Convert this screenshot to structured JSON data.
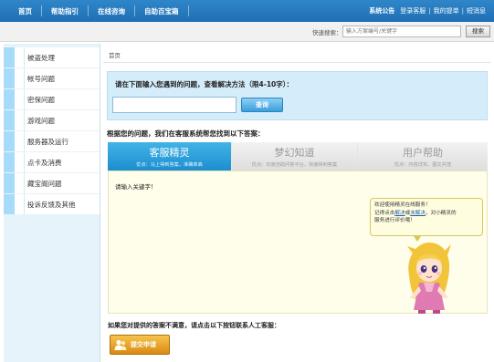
{
  "topnav": {
    "items": [
      "首页",
      "帮助指引",
      "在线咨询",
      "自助百宝箱"
    ]
  },
  "toplinks": {
    "announce": "系统公告",
    "login": "登录客服",
    "orders": "我的提单",
    "messages": "短消息"
  },
  "search": {
    "label": "快速搜索：",
    "placeholder": "输入方案编号/关键字",
    "button": "搜索"
  },
  "sidebar": {
    "items": [
      {
        "label": "被盗处理"
      },
      {
        "label": "帐号问题"
      },
      {
        "label": "密保问题"
      },
      {
        "label": "游戏问题"
      },
      {
        "label": "服务器及运行"
      },
      {
        "label": "点卡及消费"
      },
      {
        "label": "藏宝阁问题"
      },
      {
        "label": "投诉反馈及其他"
      }
    ]
  },
  "main": {
    "breadcrumb": "首页",
    "query": {
      "title": "请在下面输入您遇到的问题，查看解决方法（限4-10字）：",
      "input_value": "",
      "button": "查询"
    },
    "help_line": "根据您的问题，我们在客服系统帮您找到以下答案：",
    "tabs": [
      {
        "name": "客服精灵",
        "sub": "优点：马上得到答案，准确率高"
      },
      {
        "name": "梦幻知道",
        "sub": "优点：玩家自助问答平台，快速得到答案"
      },
      {
        "name": "用户帮助",
        "sub": "优点：内容详实，图文并茂"
      }
    ],
    "chat_prompt": "请输入关键字！",
    "bubble": {
      "line1": "欢迎使用精灵在线服务！",
      "line2_pre": "记得点击",
      "link1": "解决",
      "mid": "或",
      "link2": "未解决",
      "line2_post": "，对小精灵的",
      "line3": "服务进行评价哦！"
    },
    "complain_text": "如果您对提供的答案不满意，请点击以下按钮联系人工客服：",
    "submit_button": "提交申请"
  },
  "colors": {
    "top_bar": "#1f6fb3",
    "accent": "#1c8ed0",
    "sidebar_stripe": "#a7dcf8",
    "submit": "#d98a11"
  },
  "icons": {
    "submit": "user-icon",
    "mascot": "mascot-illustration"
  }
}
